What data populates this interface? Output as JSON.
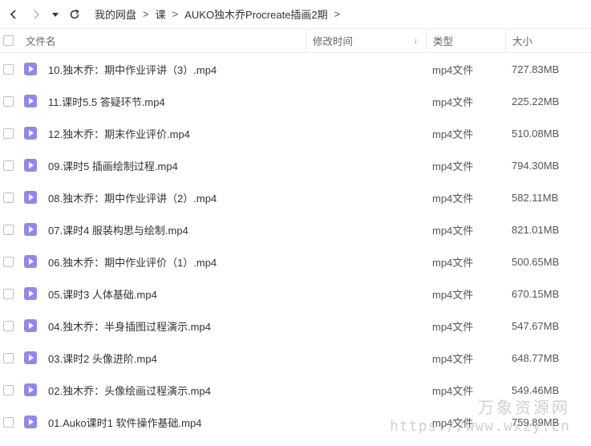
{
  "breadcrumb": {
    "items": [
      "我的网盘",
      "课",
      "AUKO独木乔Procreate插画2期"
    ],
    "separator": ">"
  },
  "table": {
    "headers": {
      "name": "文件名",
      "mtime": "修改时间",
      "type": "类型",
      "size": "大小"
    },
    "sort_icon": "arrow-down-icon",
    "rows": [
      {
        "name": "10.独木乔：期中作业评讲（3）.mp4",
        "type": "mp4文件",
        "size": "727.83MB"
      },
      {
        "name": "11.课时5.5 答疑环节.mp4",
        "type": "mp4文件",
        "size": "225.22MB"
      },
      {
        "name": "12.独木乔：期末作业评价.mp4",
        "type": "mp4文件",
        "size": "510.08MB"
      },
      {
        "name": "09.课时5 插画绘制过程.mp4",
        "type": "mp4文件",
        "size": "794.30MB"
      },
      {
        "name": "08.独木乔：期中作业评讲（2）.mp4",
        "type": "mp4文件",
        "size": "582.11MB"
      },
      {
        "name": "07.课时4 服装构思与绘制.mp4",
        "type": "mp4文件",
        "size": "821.01MB"
      },
      {
        "name": "06.独木乔：期中作业评价（1）.mp4",
        "type": "mp4文件",
        "size": "500.65MB"
      },
      {
        "name": "05.课时3 人体基础.mp4",
        "type": "mp4文件",
        "size": "670.15MB"
      },
      {
        "name": "04.独木乔：半身插图过程演示.mp4",
        "type": "mp4文件",
        "size": "547.67MB"
      },
      {
        "name": "03.课时2 头像进阶.mp4",
        "type": "mp4文件",
        "size": "648.77MB"
      },
      {
        "name": "02.独木乔：头像绘画过程演示.mp4",
        "type": "mp4文件",
        "size": "549.46MB"
      },
      {
        "name": "01.Auko课时1 软件操作基础.mp4",
        "type": "mp4文件",
        "size": "759.89MB"
      }
    ]
  },
  "watermark": {
    "title": "万象资源网",
    "url": "https://www.wxzy.cn"
  },
  "colors": {
    "file_icon": "#8f89ec",
    "sort_accent": "#3d9df6"
  }
}
